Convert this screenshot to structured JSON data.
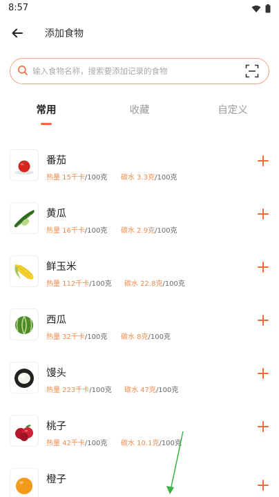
{
  "status_bar": {
    "time": "8:57"
  },
  "header": {
    "title": "添加食物"
  },
  "search": {
    "placeholder": "输入食物名称，搜索要添加记录的食物"
  },
  "tabs": [
    {
      "label": "常用",
      "active": true
    },
    {
      "label": "收藏",
      "active": false
    },
    {
      "label": "自定义",
      "active": false
    }
  ],
  "foods": [
    {
      "name": "番茄",
      "energy_label": "热量 15千卡",
      "energy_unit": "/100克",
      "carb_label": "碳水 3.3克",
      "carb_unit": "/100克",
      "icon": "tomato-icon"
    },
    {
      "name": "黄瓜",
      "energy_label": "热量 16千卡",
      "energy_unit": "/100克",
      "carb_label": "碳水 2.9克",
      "carb_unit": "/100克",
      "icon": "cucumber-icon"
    },
    {
      "name": "鲜玉米",
      "energy_label": "热量 112千卡",
      "energy_unit": "/100克",
      "carb_label": "碳水 22.8克",
      "carb_unit": "/100克",
      "icon": "corn-icon"
    },
    {
      "name": "西瓜",
      "energy_label": "热量 32千卡",
      "energy_unit": "/100克",
      "carb_label": "碳水 8克",
      "carb_unit": "/100克",
      "icon": "watermelon-icon"
    },
    {
      "name": "馒头",
      "energy_label": "热量 223千卡",
      "energy_unit": "/100克",
      "carb_label": "碳水 47克",
      "carb_unit": "/100克",
      "icon": "steamed-bun-icon"
    },
    {
      "name": "桃子",
      "energy_label": "热量 42千卡",
      "energy_unit": "/100克",
      "carb_label": "碳水 10.1克",
      "carb_unit": "/100克",
      "icon": "peach-icon"
    },
    {
      "name": "橙子",
      "energy_label": "",
      "energy_unit": "",
      "carb_label": "",
      "carb_unit": "",
      "icon": "orange-icon"
    }
  ],
  "colors": {
    "accent": "#f06a3b",
    "nutrient_highlight": "#f08a4b",
    "search_border": "#f0a585"
  }
}
